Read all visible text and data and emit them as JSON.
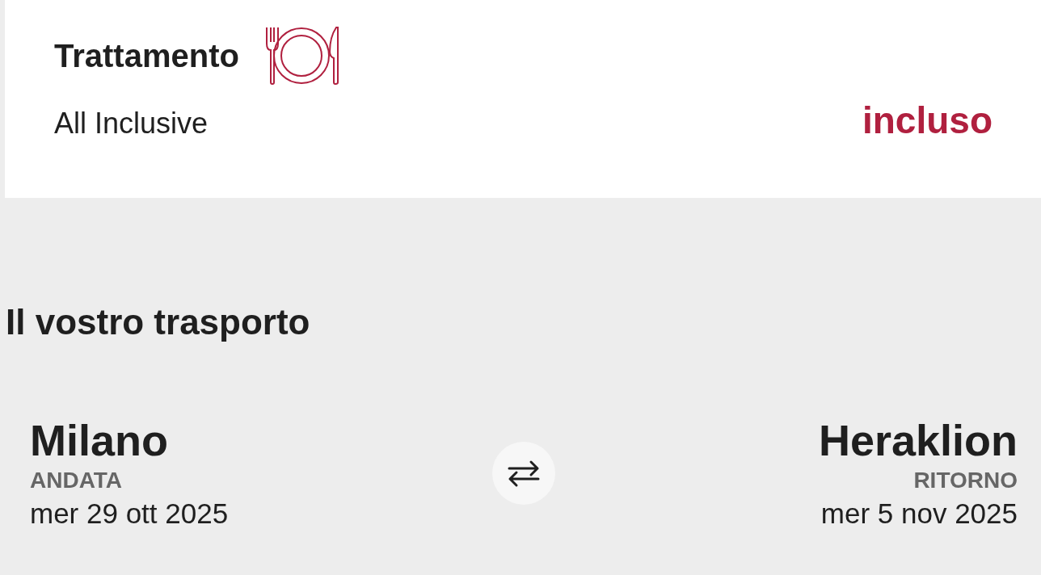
{
  "board": {
    "title": "Trattamento",
    "value": "All Inclusive",
    "price": "incluso"
  },
  "transport": {
    "heading": "Il vostro trasporto",
    "legs": [
      {
        "city": "Milano",
        "label": "ANDATA",
        "date": "mer 29 ott 2025"
      },
      {
        "city": "Heraklion",
        "label": "RITORNO",
        "date": "mer 5 nov 2025"
      }
    ]
  }
}
